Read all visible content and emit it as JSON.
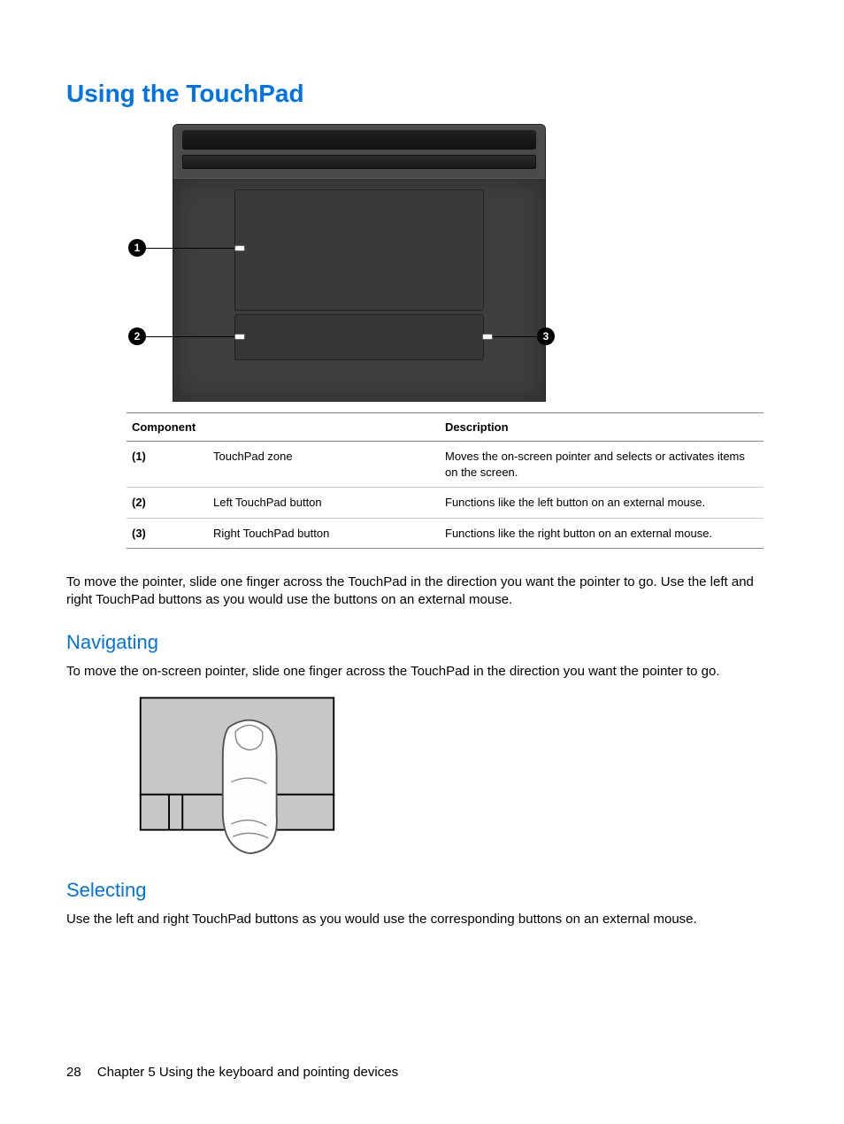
{
  "heading_main": "Using the TouchPad",
  "figure1": {
    "callouts": {
      "c1": "1",
      "c2": "2",
      "c3": "3"
    }
  },
  "table": {
    "headers": {
      "component": "Component",
      "description": "Description"
    },
    "rows": [
      {
        "num": "(1)",
        "name": "TouchPad zone",
        "desc": "Moves the on-screen pointer and selects or activates items on the screen."
      },
      {
        "num": "(2)",
        "name": "Left TouchPad button",
        "desc": "Functions like the left button on an external mouse."
      },
      {
        "num": "(3)",
        "name": "Right TouchPad button",
        "desc": "Functions like the right button on an external mouse."
      }
    ]
  },
  "para_intro": "To move the pointer, slide one finger across the TouchPad in the direction you want the pointer to go. Use the left and right TouchPad buttons as you would use the buttons on an external mouse.",
  "heading_nav": "Navigating",
  "para_nav": "To move the on-screen pointer, slide one finger across the TouchPad in the direction you want the pointer to go.",
  "heading_sel": "Selecting",
  "para_sel": "Use the left and right TouchPad buttons as you would use the corresponding buttons on an external mouse.",
  "footer": {
    "page_number": "28",
    "chapter": "Chapter 5   Using the keyboard and pointing devices"
  }
}
